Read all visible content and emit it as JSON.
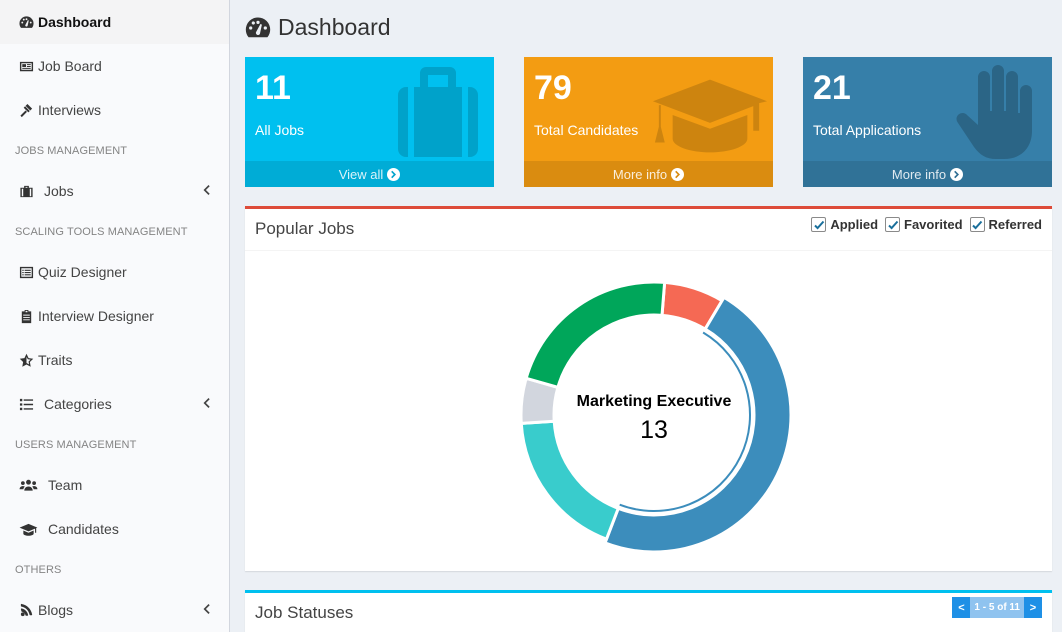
{
  "sidebar": {
    "items": [
      {
        "label": "Dashboard",
        "icon": "dashboard-icon"
      },
      {
        "label": "Job Board",
        "icon": "newspaper-icon"
      },
      {
        "label": "Interviews",
        "icon": "gavel-icon"
      },
      {
        "header": "JOBS MANAGEMENT"
      },
      {
        "label": "Jobs",
        "icon": "briefcase-icon"
      },
      {
        "header": "SCALING TOOLS MANAGEMENT"
      },
      {
        "label": "Quiz Designer",
        "icon": "list-alt-icon"
      },
      {
        "label": "Interview Designer",
        "icon": "clipboard-icon"
      },
      {
        "label": "Traits",
        "icon": "star-half-icon"
      },
      {
        "label": "Categories",
        "icon": "list-icon"
      },
      {
        "header": "USERS MANAGEMENT"
      },
      {
        "label": "Team",
        "icon": "users-icon"
      },
      {
        "label": "Candidates",
        "icon": "graduation-cap-icon"
      },
      {
        "header": "OTHERS"
      },
      {
        "label": "Blogs",
        "icon": "blog-icon"
      }
    ]
  },
  "page": {
    "title": "Dashboard"
  },
  "stats": [
    {
      "value": "11",
      "label": "All Jobs",
      "link": "View all",
      "color": "#00c0ef",
      "icon": "suitcase-icon"
    },
    {
      "value": "79",
      "label": "Total Candidates",
      "link": "More info",
      "color": "#f39c12",
      "icon": "graduation-cap-icon"
    },
    {
      "value": "21",
      "label": "Total Applications",
      "link": "More info",
      "color": "#367fa9",
      "icon": "hand-icon"
    }
  ],
  "popular_jobs": {
    "title": "Popular Jobs",
    "filters": [
      "Applied",
      "Favorited",
      "Referred"
    ],
    "center_label": "Marketing Executive",
    "center_value": "13"
  },
  "job_statuses": {
    "title": "Job Statuses",
    "pager": {
      "prev": "<",
      "info": "1 - 5 of 11",
      "next": ">"
    }
  },
  "chart_data": {
    "type": "pie",
    "values": [
      2,
      13,
      5,
      1.5,
      6
    ],
    "colors": [
      "#f56954",
      "#3c8dbc",
      "#39cccc",
      "#d2d6de",
      "#00a65a"
    ],
    "highlighted_index": 1
  }
}
